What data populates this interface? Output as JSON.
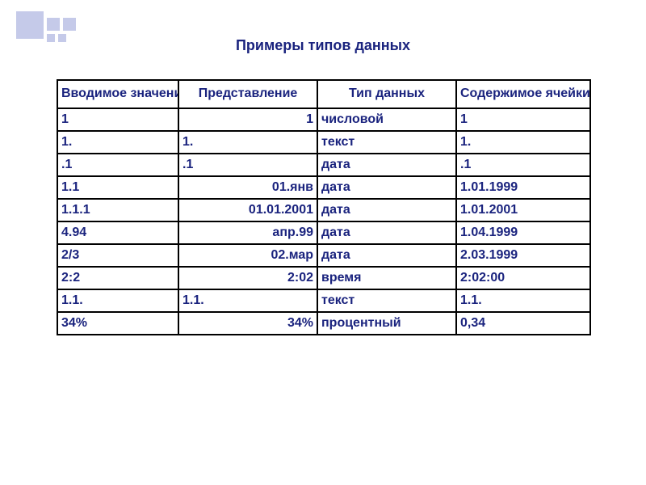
{
  "title": "Примеры типов данных",
  "headers": [
    "Вводимое значение",
    "Представление",
    "Тип данных",
    "Содержимое ячейки"
  ],
  "rows": [
    {
      "input": "1",
      "repr": "1",
      "repr_align": "right",
      "type": "числовой",
      "content": "1"
    },
    {
      "input": "1.",
      "repr": "1.",
      "repr_align": "left",
      "type": "текст",
      "content": "1."
    },
    {
      "input": ".1",
      "repr": ".1",
      "repr_align": "left",
      "type": "дата",
      "content": ".1"
    },
    {
      "input": "1.1",
      "repr": "01.янв",
      "repr_align": "right",
      "type": "дата",
      "content": "1.01.1999"
    },
    {
      "input": "1.1.1",
      "repr": "01.01.2001",
      "repr_align": "right",
      "type": "дата",
      "content": "1.01.2001"
    },
    {
      "input": "4.94",
      "repr": "апр.99",
      "repr_align": "right",
      "type": "дата",
      "content": "1.04.1999"
    },
    {
      "input": "2/3",
      "repr": "02.мар",
      "repr_align": "right",
      "type": "дата",
      "content": "2.03.1999"
    },
    {
      "input": "2:2",
      "repr": "2:02",
      "repr_align": "right",
      "type": "время",
      "content": "2:02:00"
    },
    {
      "input": "1.1.",
      "repr": "1.1.",
      "repr_align": "left",
      "type": "текст",
      "content": "1.1."
    },
    {
      "input": "34%",
      "repr": "34%",
      "repr_align": "right",
      "type": "процентный",
      "content": "0,34"
    }
  ]
}
